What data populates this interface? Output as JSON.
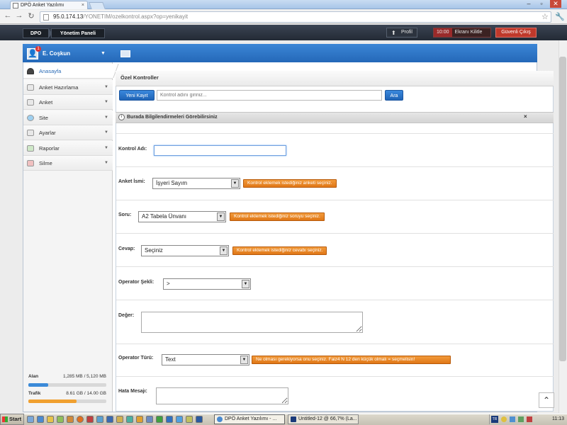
{
  "browser": {
    "tab_title": "DPÖ Anket Yazılımı",
    "tab_close": "×",
    "url_host": "95.0.174.13",
    "url_path": "/YONETIM/ozelkontrol.aspx?op=yenikayit",
    "window_buttons": [
      "–",
      "▫",
      "✕"
    ]
  },
  "appnav": {
    "crumb1": "DPO",
    "crumb2": "Yönetim Paneli",
    "profil": "Profil",
    "lock_time": "10:00",
    "lock_label": "Ekranı Kilitle",
    "logout": "Güvenli Çıkış"
  },
  "user": {
    "name": "E. Coşkun",
    "badge": "1"
  },
  "sidebar": {
    "items": [
      {
        "label": "Anasayfa"
      },
      {
        "label": "Anket Hazırlama"
      },
      {
        "label": "Anket"
      },
      {
        "label": "Site"
      },
      {
        "label": "Ayarlar"
      },
      {
        "label": "Raporlar"
      },
      {
        "label": "Silme"
      }
    ]
  },
  "stats": {
    "alan_label": "Alan",
    "alan_value": "1,285 MB / 5,120 MB",
    "alan_fraction": 0.251,
    "trafik_label": "Trafik",
    "trafik_value": "8.61 GB / 14.00 GB",
    "trafik_fraction": 0.615,
    "alan_color": "#3b8ad8",
    "trafik_color": "#f0a030"
  },
  "panel": {
    "title": "Özel Kontroller",
    "new_button": "Yeni Kayıt",
    "search_placeholder": "Kontrol adını giriniz...",
    "search_button": "Ara",
    "info_text": "Burada Bilgilendirmeleri Görebilirsiniz",
    "info_close": "×"
  },
  "form": {
    "kontrol_adi_label": "Kontrol Adı:",
    "anket_ismi_label": "Anket İsmi:",
    "anket_ismi_value": "İşyeri Sayım",
    "anket_ismi_hint": "Kontrol eklemek istediğiniz anketi seçiniz.",
    "soru_label": "Soru:",
    "soru_value": "A2 Tabela Ünvanı",
    "soru_hint": "Kontrol eklemek istediğiniz soruyu seçiniz.",
    "cevap_label": "Cevap:",
    "cevap_value": "Seçiniz",
    "cevap_hint": "Kontrol eklemek istediğiniz cevabı seçiniz.",
    "operator_sekli_label": "Operator Şekli:",
    "operator_sekli_value": ">",
    "deger_label": "Değer:",
    "operator_turu_label": "Operator Türü:",
    "operator_turu_value": "Text",
    "operator_turu_hint": "Ne olması gerekiyorsa onu seçiniz. Faiz4 N 12 den küçük olmalı = seçmelisin!",
    "hata_mesaji_label": "Hata Mesajı:"
  },
  "taskbar": {
    "start": "Start",
    "task1": "DPÖ Anket Yazılımı - ...",
    "task2": "Untitled-12 @ 66,7% (La...",
    "lang": "TR",
    "clock": "11:13"
  },
  "colors": {
    "accent": "#2a6bb6",
    "hint_orange": "#e07717",
    "logout_red": "#c0392b"
  }
}
